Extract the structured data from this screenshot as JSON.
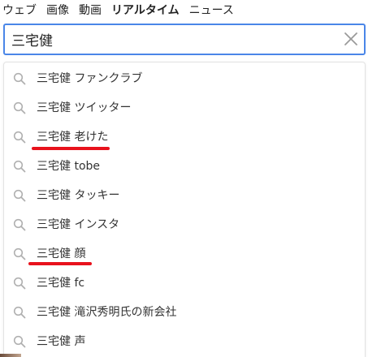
{
  "tabs": [
    {
      "label": "ウェブ"
    },
    {
      "label": "画像"
    },
    {
      "label": "動画"
    },
    {
      "label": "リアルタイム",
      "active": true
    },
    {
      "label": "ニュース"
    }
  ],
  "search": {
    "value": "三宅健"
  },
  "icons": {
    "clear": "close-icon",
    "suggestion": "search-icon"
  },
  "suggestions": [
    {
      "text": "三宅健 ファンクラブ"
    },
    {
      "text": "三宅健 ツイッター"
    },
    {
      "text": "三宅健 老けた",
      "highlighted": true
    },
    {
      "text": "三宅健 tobe"
    },
    {
      "text": "三宅健 タッキー"
    },
    {
      "text": "三宅健 インスタ"
    },
    {
      "text": "三宅健 顔",
      "highlighted": true
    },
    {
      "text": "三宅健 fc"
    },
    {
      "text": "三宅健 滝沢秀明氏の新会社"
    },
    {
      "text": "三宅健 声"
    }
  ],
  "colors": {
    "search_border": "#4a86e8",
    "underline": "#e8121c",
    "icon_gray": "#b0b0b0"
  }
}
